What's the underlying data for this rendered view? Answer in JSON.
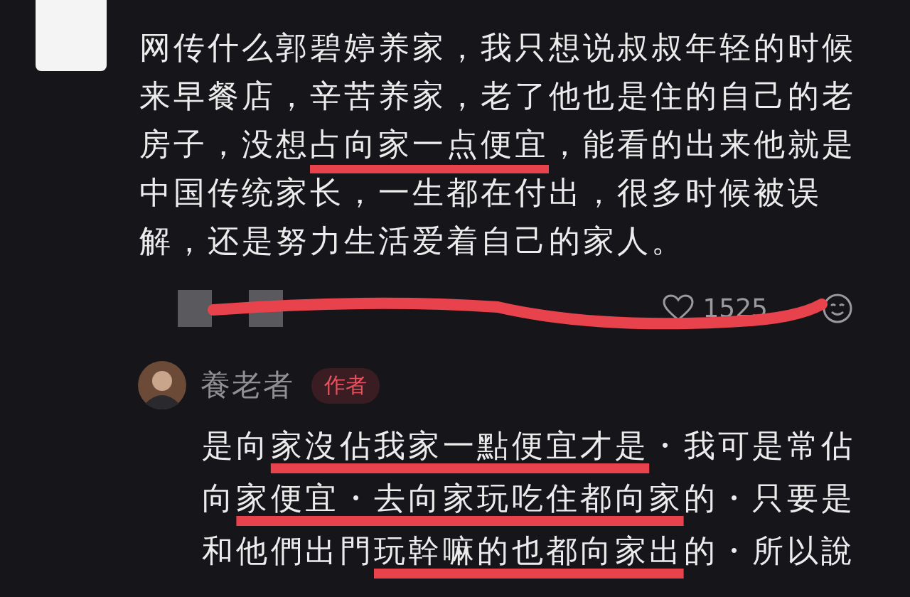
{
  "comment": {
    "text": "网传什么郭碧婷养家，我只想说叔叔年轻的时候来早餐店，辛苦养家，老了他也是住的自己的老房子，没想**占向家一点便宜**，能看的出来他就是中国传统家长，一生都在付出，很多时候被误解，还是努力生活爱着自己的家人。",
    "likes": "1525"
  },
  "reply": {
    "author": "養老者",
    "badge": "作者",
    "text": "是向**家沒佔我家一點便宜才是**・我可是常佔向**家便宜・去向家玩吃住都向家**的・只要是和他們出門**玩幹嘛的也都向家出**的・所以說"
  }
}
